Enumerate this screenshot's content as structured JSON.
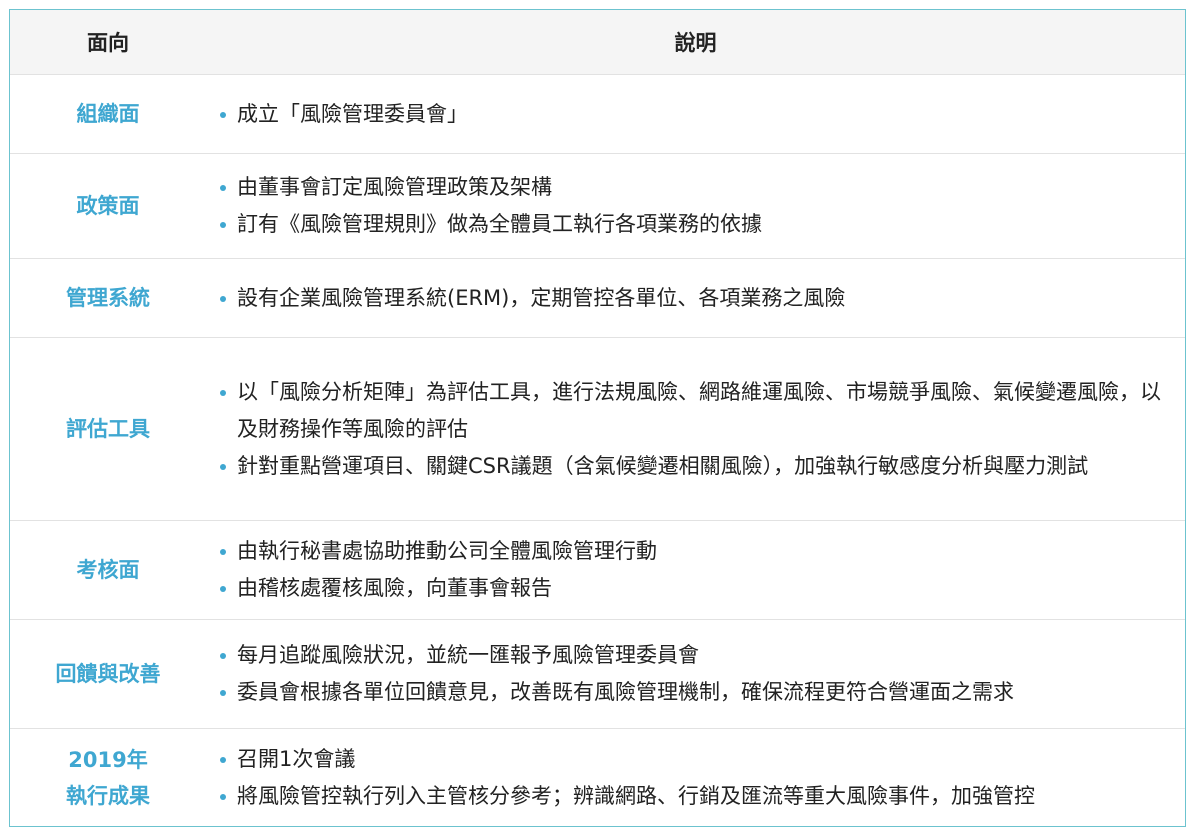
{
  "header": {
    "col1": "面向",
    "col2": "說明"
  },
  "rows": [
    {
      "category": "組織面",
      "items": [
        "成立「風險管理委員會」"
      ]
    },
    {
      "category": "政策面",
      "items": [
        "由董事會訂定風險管理政策及架構",
        "訂有《風險管理規則》做為全體員工執行各項業務的依據"
      ]
    },
    {
      "category": "管理系統",
      "items": [
        "設有企業風險管理系統(ERM)，定期管控各單位、各項業務之風險"
      ]
    },
    {
      "category": "評估工具",
      "items": [
        "以「風險分析矩陣」為評估工具，進行法規風險、網路維運風險、市場競爭風險、氣候變遷風險，以及財務操作等風險的評估",
        "針對重點營運項目、關鍵CSR議題（含氣候變遷相關風險），加強執行敏感度分析與壓力測試"
      ]
    },
    {
      "category": "考核面",
      "items": [
        "由執行秘書處協助推動公司全體風險管理行動",
        "由稽核處覆核風險，向董事會報告"
      ]
    },
    {
      "category": "回饋與改善",
      "items": [
        "每月追蹤風險狀況，並統一匯報予風險管理委員會",
        "委員會根據各單位回饋意見，改善既有風險管理機制，確保流程更符合營運面之需求"
      ]
    },
    {
      "category_line1": "2019年",
      "category_line2": "執行成果",
      "items": [
        "召開1次會議",
        "將風險管控執行列入主管核分參考；辨識網路、行銷及匯流等重大風險事件，加強管控"
      ]
    }
  ],
  "colors": {
    "accent": "#3fa7d1",
    "border": "#6cc3cf",
    "header_bg": "#f5f5f5"
  }
}
